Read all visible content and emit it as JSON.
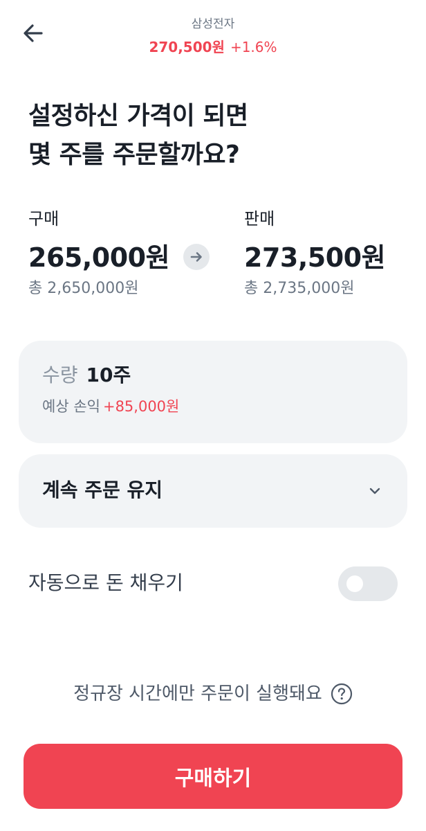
{
  "header": {
    "stock_name": "삼성전자",
    "current_price": "270,500원",
    "change": "+1.6%",
    "back_icon": "arrow-left-icon"
  },
  "question": {
    "line1": "설정하신 가격이 되면",
    "line2": "몇 주를 주문할까요?"
  },
  "buy": {
    "label": "구매",
    "price": "265,000원",
    "total": "총 2,650,000원"
  },
  "sell": {
    "label": "판매",
    "price": "273,500원",
    "total": "총 2,735,000원"
  },
  "quantity": {
    "label": "수량",
    "value": "10주",
    "profit_label": "예상 손익",
    "profit_value": "+85,000원"
  },
  "order_keep": {
    "label": "계속 주문 유지",
    "icon": "chevron-down-icon"
  },
  "auto_fill": {
    "label": "자동으로 돈 채우기",
    "enabled": false
  },
  "notice": {
    "text": "정규장 시간에만 주문이 실행돼요",
    "icon": "question-circle-icon"
  },
  "cta": {
    "label": "구매하기"
  },
  "colors": {
    "accent_red": "#f04452",
    "card_bg": "#f2f4f6",
    "text_primary": "#191f28",
    "text_secondary": "#6b7684"
  }
}
